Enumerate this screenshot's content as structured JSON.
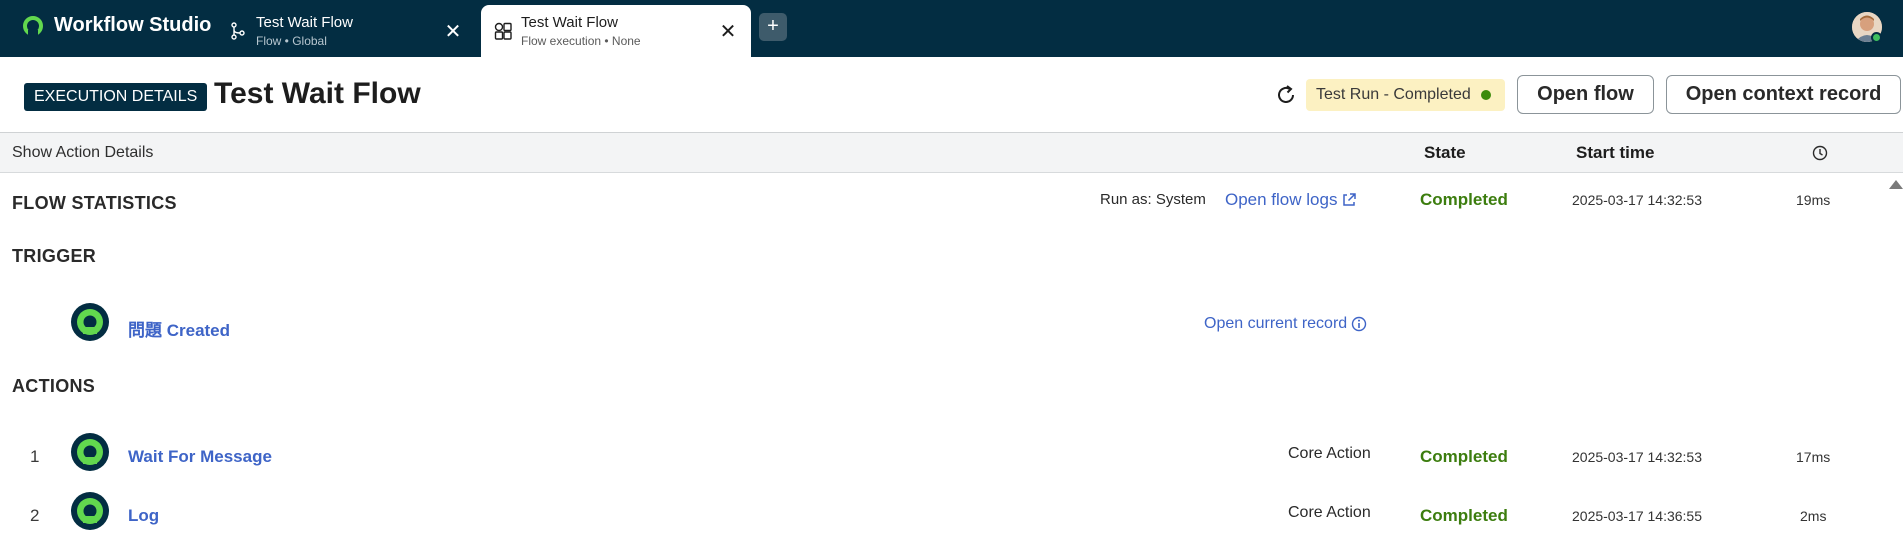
{
  "app": {
    "title": "Workflow Studio"
  },
  "tabs": [
    {
      "title": "Test Wait Flow",
      "subtitle": "Flow • Global"
    },
    {
      "title": "Test Wait Flow",
      "subtitle": "Flow execution • None"
    }
  ],
  "new_tab_label": "+",
  "close_glyph": "✕",
  "header": {
    "badge": "EXECUTION DETAILS",
    "title": "Test Wait Flow",
    "status": "Test Run - Completed",
    "open_flow": "Open flow",
    "open_context": "Open context record"
  },
  "columns": {
    "show_details": "Show Action Details",
    "state": "State",
    "start_time": "Start time"
  },
  "flow_statistics": {
    "heading": "FLOW STATISTICS",
    "run_as": "Run as: System",
    "logs_link": "Open flow logs",
    "state": "Completed",
    "start": "2025-03-17 14:32:53",
    "duration": "19ms"
  },
  "trigger": {
    "heading": "TRIGGER",
    "name": "問題 Created",
    "record_link": "Open current record"
  },
  "actions": {
    "heading": "ACTIONS",
    "rows": [
      {
        "num": "1",
        "name": "Wait For Message",
        "type": "Core Action",
        "state": "Completed",
        "start": "2025-03-17 14:32:53",
        "duration": "17ms"
      },
      {
        "num": "2",
        "name": "Log",
        "type": "Core Action",
        "state": "Completed",
        "start": "2025-03-17 14:36:55",
        "duration": "2ms"
      }
    ]
  },
  "colors": {
    "topbar": "#032d42",
    "accent_green": "#62d84e",
    "link": "#3e64c7",
    "completed": "#3c7d0e",
    "status_bg": "#fcf1c2"
  },
  "icons": {
    "brand": "workflow-logo-icon",
    "tab1": "flow-branch-icon",
    "tab2": "execution-shapes-icon",
    "refresh": "refresh-icon",
    "external": "external-link-icon",
    "info": "info-icon",
    "clock": "clock-icon",
    "node": "step-node-icon"
  }
}
